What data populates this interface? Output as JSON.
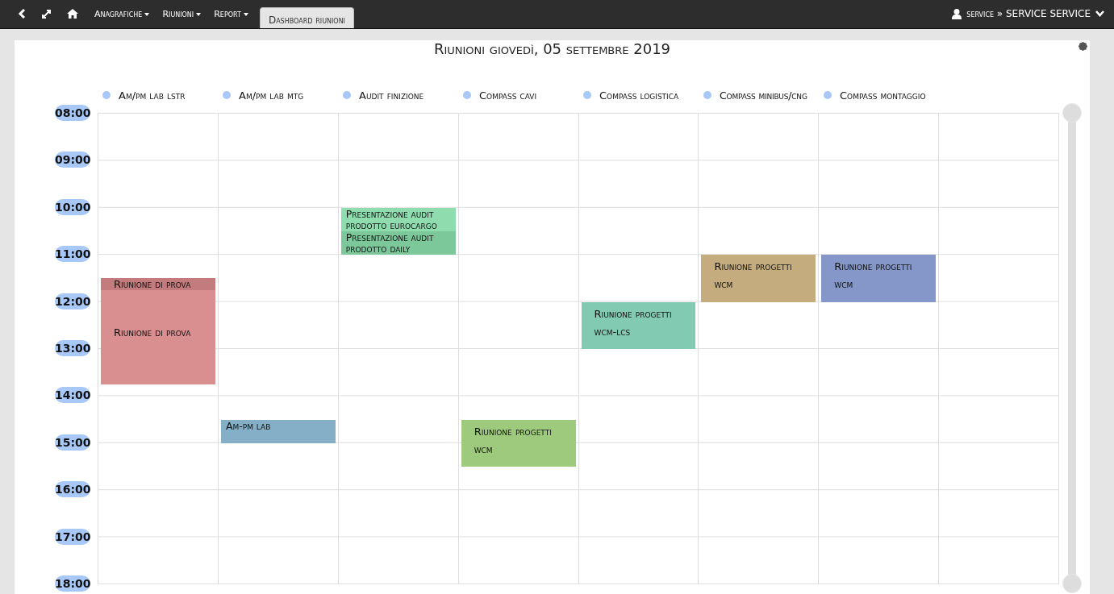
{
  "navbar": {
    "menus": [
      {
        "label": "Anagrafiche"
      },
      {
        "label": "Riunioni"
      },
      {
        "label": "Report"
      }
    ],
    "tabs": [
      {
        "label": "Dashboard riunioni",
        "selected": true
      }
    ],
    "user": "service » SERVICE SERVICE"
  },
  "title": "Riunioni giovedì, 05 settembre 2019",
  "legend": [
    {
      "label": "Am/pm lab lstr"
    },
    {
      "label": "Am/pm lab mtg"
    },
    {
      "label": "Audit finizione"
    },
    {
      "label": "Compass cavi"
    },
    {
      "label": "Compass logistica"
    },
    {
      "label": "Compass minibus/cng"
    },
    {
      "label": "Compass montaggio"
    }
  ],
  "calendar": {
    "hours": [
      {
        "label": "08:00"
      },
      {
        "label": "09:00"
      },
      {
        "label": "10:00",
        "cells": [
          {},
          {},
          {
            "events": [
              {
                "title": "Presentazione audit prodotto eurocargo",
                "color": "#8fdcae",
                "kind": "first-half"
              },
              {
                "title": "Presentazione audit prodotto daily",
                "color": "#7dc89b",
                "kind": "second-half"
              }
            ]
          },
          {},
          {},
          {},
          {},
          {}
        ]
      },
      {
        "label": "11:00",
        "cells": [
          {
            "events": [
              {
                "title": "Riunione di prova",
                "color": "#c47b7d",
                "kind": "strip"
              },
              {
                "title": "Riunione di prova",
                "color": "#d98e90",
                "kind": "long"
              }
            ]
          },
          {},
          {},
          {},
          {},
          {
            "events": [
              {
                "title": "Riunione progetti wcm",
                "color": "#c4ac7e",
                "kind": "hour"
              }
            ]
          },
          {
            "events": [
              {
                "title": "Riunione progetti wcm",
                "color": "#8497c8",
                "kind": "hour"
              }
            ]
          },
          {}
        ]
      },
      {
        "label": "12:00",
        "cells": [
          {},
          {},
          {},
          {},
          {
            "events": [
              {
                "title": "Riunione progetti wcm-lcs",
                "color": "#82cab2",
                "kind": "hour"
              }
            ]
          },
          {},
          {},
          {}
        ]
      },
      {
        "label": "13:00"
      },
      {
        "label": "14:00",
        "cells": [
          {},
          {
            "events": [
              {
                "title": "Am-pm lab",
                "color": "#84afc6",
                "kind": "second-half"
              }
            ]
          },
          {},
          {
            "events": [
              {
                "title": "Riunione progetti wcm",
                "color": "#9dca7c",
                "kind": "late-hour"
              }
            ]
          },
          {},
          {},
          {},
          {}
        ]
      },
      {
        "label": "15:00"
      },
      {
        "label": "16:00"
      },
      {
        "label": "17:00"
      },
      {
        "label": "18:00"
      }
    ]
  }
}
